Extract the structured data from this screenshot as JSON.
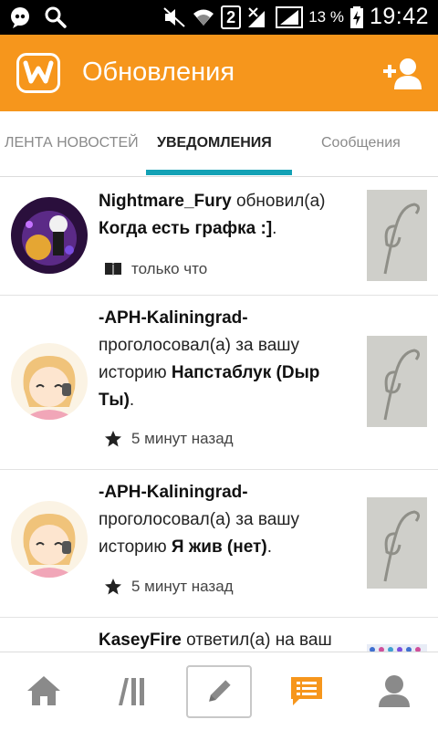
{
  "status_bar": {
    "sim_badge": "2",
    "battery": "13 %",
    "time": "19:42"
  },
  "app_bar": {
    "title": "Обновления"
  },
  "tabs": [
    {
      "label": "ЛЕНТА НОВОСТЕЙ",
      "active": false
    },
    {
      "label": "УВЕДОМЛЕНИЯ",
      "active": true
    },
    {
      "label": "Сообщения",
      "active": false
    }
  ],
  "notifications": [
    {
      "user": "Nightmare_Fury",
      "action": " обновил(а) ",
      "story": "Когда есть графка :]",
      "tail": ".",
      "time": "только что",
      "time_icon": "book-icon"
    },
    {
      "user": "-APH-Kaliningrad-",
      "action": " проголосовал(а) за вашу историю ",
      "story": "Напстаблук (Dыр Ты)",
      "tail": ".",
      "time": "5 минут назад",
      "time_icon": "star-icon"
    },
    {
      "user": "-APH-Kaliningrad-",
      "action": " проголосовал(а) за вашу историю ",
      "story": "Я жив (нет)",
      "tail": ".",
      "time": "5 минут назад",
      "time_icon": "star-icon"
    },
    {
      "user": "KaseyFire",
      "action": " ответил(а) на ваш",
      "story": "",
      "tail": "",
      "time": "",
      "time_icon": ""
    }
  ],
  "bottom_nav": [
    {
      "icon": "home-icon"
    },
    {
      "icon": "library-icon"
    },
    {
      "icon": "pencil-icon"
    },
    {
      "icon": "notifications-icon",
      "active": true
    },
    {
      "icon": "profile-icon"
    }
  ],
  "colors": {
    "accent": "#f6961c",
    "tab_indicator": "#13a1b5",
    "inactive_icon": "#888888"
  }
}
